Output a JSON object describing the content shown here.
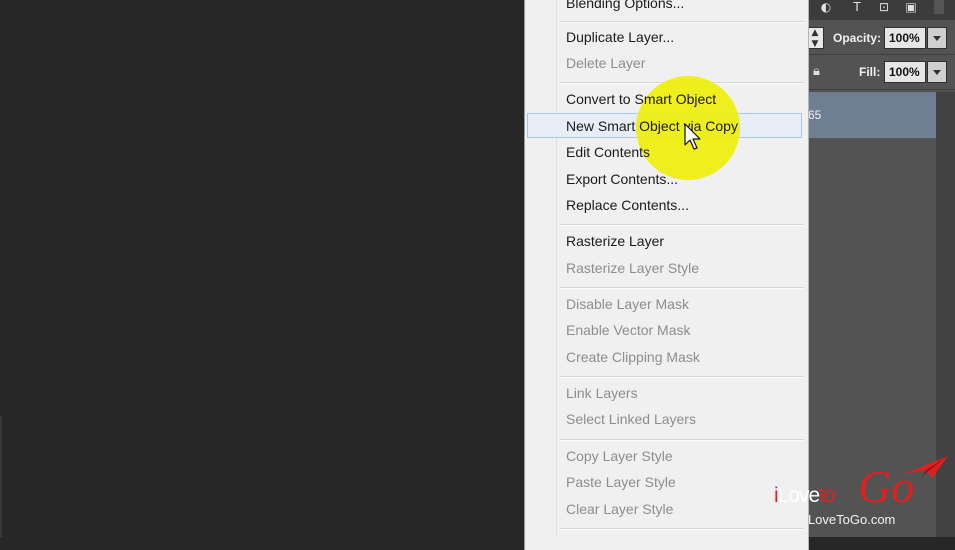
{
  "context_menu": {
    "items": [
      {
        "label": "Blending Options...",
        "disabled": false
      },
      {
        "label": "Duplicate Layer...",
        "disabled": false
      },
      {
        "label": "Delete Layer",
        "disabled": true
      },
      {
        "label": "Convert to Smart Object",
        "disabled": false
      },
      {
        "label": "New Smart Object via Copy",
        "disabled": false,
        "highlighted": true
      },
      {
        "label": "Edit Contents",
        "disabled": false
      },
      {
        "label": "Export Contents...",
        "disabled": false
      },
      {
        "label": "Replace Contents...",
        "disabled": false
      },
      {
        "label": "Rasterize Layer",
        "disabled": false
      },
      {
        "label": "Rasterize Layer Style",
        "disabled": true
      },
      {
        "label": "Disable Layer Mask",
        "disabled": true
      },
      {
        "label": "Enable Vector Mask",
        "disabled": true
      },
      {
        "label": "Create Clipping Mask",
        "disabled": true
      },
      {
        "label": "Link Layers",
        "disabled": true
      },
      {
        "label": "Select Linked Layers",
        "disabled": true
      },
      {
        "label": "Copy Layer Style",
        "disabled": true
      },
      {
        "label": "Paste Layer Style",
        "disabled": true
      },
      {
        "label": "Clear Layer Style",
        "disabled": true
      }
    ]
  },
  "layers_panel": {
    "opacity_label": "Opacity:",
    "opacity_value": "100%",
    "fill_label": "Fill:",
    "fill_value": "100%",
    "selected_layer_text": "65",
    "layer_highlight_color": "#6e7f93"
  },
  "watermark": {
    "brand_i": "i",
    "brand_love": "Love",
    "brand_to": "to",
    "brand_go": "Go",
    "url": "www.iLoveToGo.com",
    "accent_color": "#e02020"
  },
  "colors": {
    "canvas_bg": "#272727",
    "menu_bg": "#f0f0f0",
    "menu_highlight": "#e7eef8",
    "spotlight": "#eeee00"
  },
  "icons": [
    "adjustment-icon",
    "type-icon",
    "transform-icon",
    "smart-object-icon",
    "lock-icon",
    "cursor-icon",
    "paper-plane-icon"
  ]
}
